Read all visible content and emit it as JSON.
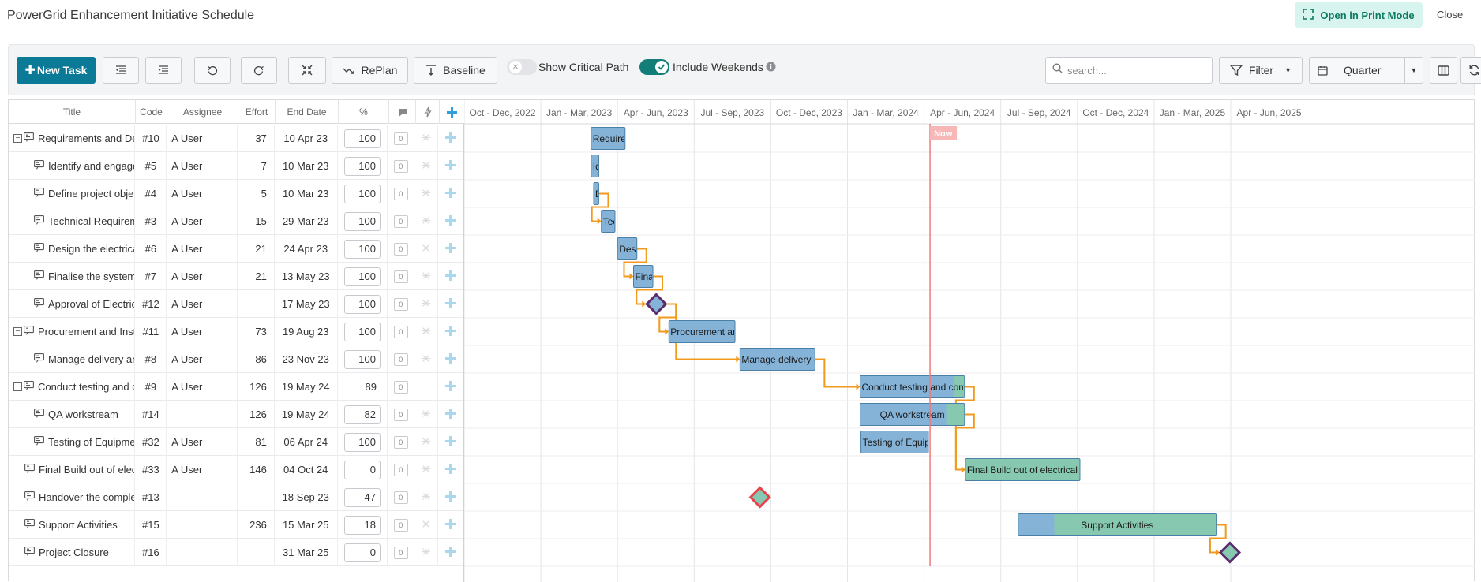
{
  "page": {
    "title": "PowerGrid Enhancement Initiative Schedule",
    "print_label": "Open in Print Mode",
    "close_label": "Close"
  },
  "toolbar": {
    "new_task_label": "New Task",
    "replan_label": "RePlan",
    "baseline_label": "Baseline",
    "critical_path_label": "Show Critical Path",
    "critical_path_on": false,
    "weekends_label": "Include Weekends",
    "weekends_on": true,
    "search_placeholder": "search...",
    "filter_label": "Filter",
    "zoom_label": "Quarter"
  },
  "columns": {
    "title": "Title",
    "code": "Code",
    "assignee": "Assignee",
    "effort": "Effort",
    "end": "End Date",
    "pct": "%"
  },
  "colors": {
    "primary": "#0b7a97",
    "bar_blue": "#85b3d8",
    "bar_green": "#86c8b0",
    "connector": "#f29a1c",
    "now_line": "#f07a7a",
    "milestone_purple": "#5a2d6e",
    "milestone_red": "#e8424c"
  },
  "timeline": {
    "quarters": [
      "Oct - Dec, 2022",
      "Jan - Mar, 2023",
      "Apr - Jun, 2023",
      "Jul - Sep, 2023",
      "Oct - Dec, 2023",
      "Jan - Mar, 2024",
      "Apr - Jun, 2024",
      "Jul - Sep, 2024",
      "Oct - Dec, 2024",
      "Jan - Mar, 2025",
      "Apr - Jun, 2025"
    ],
    "start": "2022-10-01",
    "now_label": "Now",
    "now_date": "2024-04-08"
  },
  "tasks": [
    {
      "title": "Requirements and Design",
      "code": "#10",
      "assignee": "A User",
      "effort": "37",
      "end": "10 Apr 23",
      "pct": "100",
      "comments": "0",
      "group": true,
      "level": 0,
      "bar_label": "Requirements and Design",
      "start_date": "2023-03-01",
      "end_date": "2023-04-10",
      "progress": 100,
      "type": "bar"
    },
    {
      "title": "Identify and engage stakeholders",
      "code": "#5",
      "assignee": "A User",
      "effort": "7",
      "end": "10 Mar 23",
      "pct": "100",
      "comments": "0",
      "group": false,
      "level": 1,
      "bar_label": "Identify and engage stakeholders",
      "start_date": "2023-03-01",
      "end_date": "2023-03-10",
      "progress": 100,
      "type": "bar"
    },
    {
      "title": "Define project objectives",
      "code": "#4",
      "assignee": "A User",
      "effort": "5",
      "end": "10 Mar 23",
      "pct": "100",
      "comments": "0",
      "group": false,
      "level": 1,
      "bar_label": "Define project objectives",
      "start_date": "2023-03-04",
      "end_date": "2023-03-10",
      "progress": 100,
      "type": "bar"
    },
    {
      "title": "Technical Requirements",
      "code": "#3",
      "assignee": "A User",
      "effort": "15",
      "end": "29 Mar 23",
      "pct": "100",
      "comments": "0",
      "group": false,
      "level": 1,
      "bar_label": "Technical Requirements",
      "start_date": "2023-03-13",
      "end_date": "2023-03-29",
      "progress": 100,
      "type": "bar"
    },
    {
      "title": "Design the electrical system",
      "code": "#6",
      "assignee": "A User",
      "effort": "21",
      "end": "24 Apr 23",
      "pct": "100",
      "comments": "0",
      "group": false,
      "level": 1,
      "bar_label": "Design the electrical system",
      "start_date": "2023-04-01",
      "end_date": "2023-04-24",
      "progress": 100,
      "type": "bar"
    },
    {
      "title": "Finalise the system design",
      "code": "#7",
      "assignee": "A User",
      "effort": "21",
      "end": "13 May 23",
      "pct": "100",
      "comments": "0",
      "group": false,
      "level": 1,
      "bar_label": "Finalise the system design",
      "start_date": "2023-04-20",
      "end_date": "2023-05-13",
      "progress": 100,
      "type": "bar"
    },
    {
      "title": "Approval of Electrical Design",
      "code": "#12",
      "assignee": "A User",
      "effort": "",
      "end": "17 May 23",
      "pct": "100",
      "comments": "0",
      "group": false,
      "level": 1,
      "bar_label": "",
      "start_date": "2023-05-17",
      "end_date": "2023-05-17",
      "progress": 100,
      "type": "milestone",
      "ms_color": "#85b3d8",
      "ms_border": "#5a2d6e"
    },
    {
      "title": "Procurement and Installation",
      "code": "#11",
      "assignee": "A User",
      "effort": "73",
      "end": "19 Aug 23",
      "pct": "100",
      "comments": "0",
      "group": true,
      "level": 0,
      "bar_label": "Procurement and Installation",
      "start_date": "2023-06-01",
      "end_date": "2023-08-19",
      "progress": 100,
      "type": "bar"
    },
    {
      "title": "Manage delivery and installation",
      "code": "#8",
      "assignee": "A User",
      "effort": "86",
      "end": "23 Nov 23",
      "pct": "100",
      "comments": "0",
      "group": false,
      "level": 1,
      "bar_label": "Manage delivery and installation",
      "start_date": "2023-08-25",
      "end_date": "2023-11-23",
      "progress": 100,
      "type": "bar"
    },
    {
      "title": "Conduct testing and commissioning",
      "code": "#9",
      "assignee": "A User",
      "effort": "126",
      "end": "19 May 24",
      "pct": "89",
      "comments": "0",
      "group": true,
      "level": 0,
      "pct_plain": true,
      "bar_label": "Conduct testing and commissioning",
      "start_date": "2024-01-16",
      "end_date": "2024-05-19",
      "progress": 89,
      "type": "bar"
    },
    {
      "title": "QA workstream",
      "code": "#14",
      "assignee": "",
      "effort": "126",
      "end": "19 May 24",
      "pct": "82",
      "comments": "0",
      "group": false,
      "level": 1,
      "bar_label": "QA workstream",
      "start_date": "2024-01-16",
      "end_date": "2024-05-19",
      "progress": 82,
      "type": "bar",
      "center_label": true
    },
    {
      "title": "Testing of Equipment",
      "code": "#32",
      "assignee": "A User",
      "effort": "81",
      "end": "06 Apr 24",
      "pct": "100",
      "comments": "0",
      "group": false,
      "level": 1,
      "bar_label": "Testing of Equipment",
      "start_date": "2024-01-17",
      "end_date": "2024-04-06",
      "progress": 100,
      "type": "bar"
    },
    {
      "title": "Final Build out of electrical transmission",
      "code": "#33",
      "assignee": "A User",
      "effort": "146",
      "end": "04 Oct 24",
      "pct": "0",
      "comments": "0",
      "group": false,
      "level": 0,
      "bar_label": "Final Build out of electrical transmission",
      "start_date": "2024-05-20",
      "end_date": "2024-10-04",
      "progress": 0,
      "type": "bar"
    },
    {
      "title": "Handover the completed project",
      "code": "#13",
      "assignee": "",
      "effort": "",
      "end": "18 Sep 23",
      "pct": "47",
      "comments": "0",
      "group": false,
      "level": 0,
      "bar_label": "",
      "start_date": "2023-09-18",
      "end_date": "2023-09-18",
      "progress": 47,
      "type": "milestone",
      "ms_color": "#86c8b0",
      "ms_border": "#e8424c"
    },
    {
      "title": "Support Activities",
      "code": "#15",
      "assignee": "",
      "effort": "236",
      "end": "15 Mar 25",
      "pct": "18",
      "comments": "0",
      "group": false,
      "level": 0,
      "bar_label": "Support Activities",
      "start_date": "2024-07-22",
      "end_date": "2025-03-15",
      "progress": 18,
      "type": "bar",
      "center_label": true
    },
    {
      "title": "Project Closure",
      "code": "#16",
      "assignee": "",
      "effort": "",
      "end": "31 Mar 25",
      "pct": "0",
      "comments": "0",
      "group": false,
      "level": 0,
      "bar_label": "",
      "start_date": "2025-03-31",
      "end_date": "2025-03-31",
      "progress": 0,
      "type": "milestone",
      "ms_color": "#86c8b0",
      "ms_border": "#5a2d6e"
    }
  ],
  "dependencies": [
    [
      2,
      3
    ],
    [
      4,
      5
    ],
    [
      5,
      6
    ],
    [
      6,
      7
    ],
    [
      6,
      8
    ],
    [
      8,
      9
    ],
    [
      9,
      12
    ],
    [
      10,
      12
    ],
    [
      14,
      15
    ]
  ]
}
